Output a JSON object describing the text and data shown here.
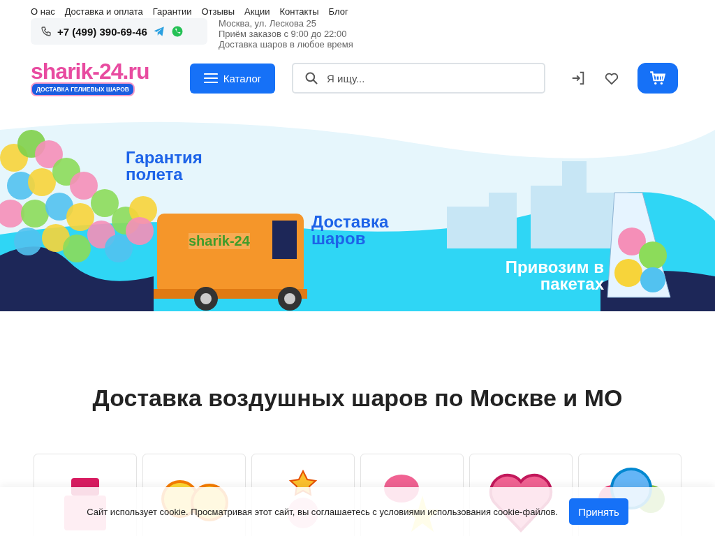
{
  "top_nav": [
    {
      "label": "О нас"
    },
    {
      "label": "Доставка и оплата"
    },
    {
      "label": "Гарантии"
    },
    {
      "label": "Отзывы"
    },
    {
      "label": "Акции"
    },
    {
      "label": "Контакты"
    },
    {
      "label": "Блог"
    }
  ],
  "phone": "+7 (499) 390-69-46",
  "info_lines": [
    "Москва, ул. Лескова 25",
    "Приём заказов с 9:00 до 22:00",
    "Доставка шаров в любое время"
  ],
  "logo": {
    "name": "sharik-24.ru",
    "tagline": "ДОСТАВКА ГЕЛИЕВЫХ ШАРОВ"
  },
  "catalog_button": "Каталог",
  "search": {
    "placeholder": "Я ищу..."
  },
  "banner": {
    "captions": [
      {
        "text": "Гарантия полета",
        "kind": "blue"
      },
      {
        "text": "Доставка шаров",
        "kind": "blue"
      },
      {
        "text": "Привозим в пакетах",
        "kind": "white"
      }
    ],
    "van_logo": "sharik-24"
  },
  "heading": "Доставка воздушных шаров по Москве и МО",
  "categories": [
    {
      "kind": "cake"
    },
    {
      "kind": "number"
    },
    {
      "kind": "figure"
    },
    {
      "kind": "heart-flower"
    },
    {
      "kind": "heart"
    },
    {
      "kind": "balloons"
    }
  ],
  "cookie": {
    "text": "Сайт использует cookie. Просматривая этот сайт, вы соглашаетесь с условиями использования cookie-файлов.",
    "button": "Принять"
  }
}
